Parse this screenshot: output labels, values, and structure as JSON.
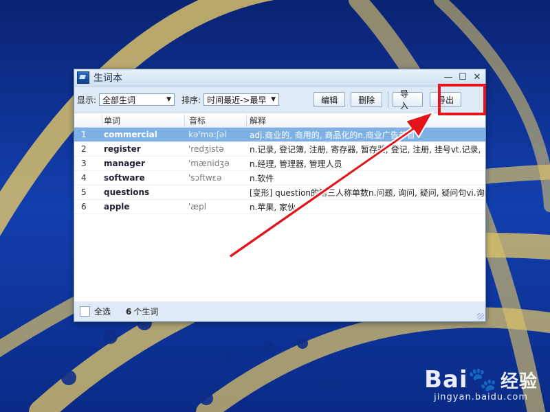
{
  "window": {
    "title": "生词本",
    "minimize": "—",
    "maximize": "☐",
    "close": "✕"
  },
  "toolbar": {
    "display_label": "显示:",
    "display_value": "全部生词",
    "sort_label": "排序:",
    "sort_value": "时间最近->最早",
    "edit": "编辑",
    "delete": "删除",
    "import": "导入",
    "export": "导出"
  },
  "table": {
    "headers": [
      "单词",
      "音标",
      "解释"
    ],
    "rows": [
      {
        "num": "1",
        "word": "commercial",
        "phonetic": "kə'mə:ʃəl",
        "definition": "adj.商业的, 商用的, 商品化的n.商业广告节目"
      },
      {
        "num": "2",
        "word": "register",
        "phonetic": "'redʒistə",
        "definition": "n.记录, 登记簿, 注册, 寄存器, 暂存器, 登记, 注册, 挂号vt.记录,"
      },
      {
        "num": "3",
        "word": "manager",
        "phonetic": "'mænidʒə",
        "definition": "n.经理, 管理器, 管理人员"
      },
      {
        "num": "4",
        "word": "software",
        "phonetic": "'sɔftwεə",
        "definition": "n.软件"
      },
      {
        "num": "5",
        "word": "questions",
        "phonetic": "",
        "definition": "[变形] question的第三人称单数n.问题, 询问, 疑问, 疑问句vi.询问"
      },
      {
        "num": "6",
        "word": "apple",
        "phonetic": "'æpl",
        "definition": "n.苹果, 家伙"
      }
    ]
  },
  "status": {
    "select_all": "全选",
    "count_value": "6",
    "count_suffix": "个生词"
  },
  "watermark": {
    "logo": "Bai",
    "logo_rest": "经验",
    "url": "jingyan.baidu.com"
  },
  "colors": {
    "highlight": "#e3151a",
    "selected_row": "#7fb0e3"
  }
}
